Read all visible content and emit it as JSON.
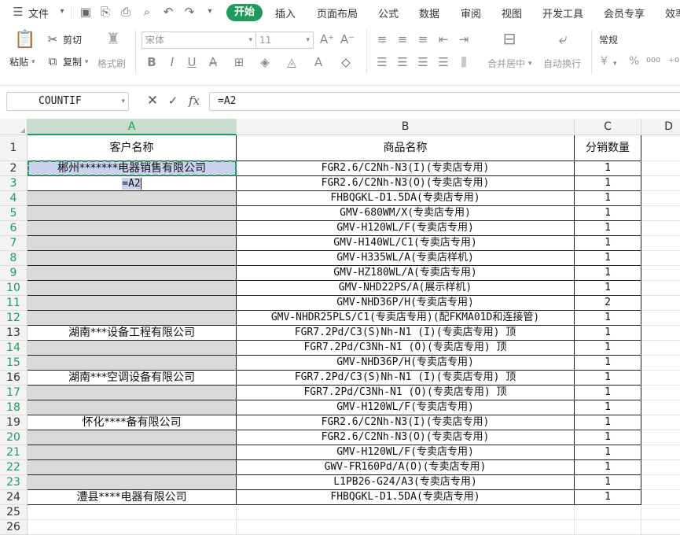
{
  "menu": {
    "file": "文件",
    "tabs": [
      "开始",
      "插入",
      "页面布局",
      "公式",
      "数据",
      "审阅",
      "视图",
      "开发工具",
      "会员专享",
      "效率"
    ]
  },
  "ribbon": {
    "paste": "粘贴",
    "cut": "剪切",
    "copy": "复制",
    "format_painter": "格式刷",
    "font_name": "宋体",
    "font_size": "11",
    "merge_center": "合并居中",
    "wrap_text": "自动换行",
    "number_format": "常规",
    "currency_symbol": "¥",
    "percent_symbol": "%"
  },
  "formula_bar": {
    "name_box": "COUNTIF",
    "fx": "fx",
    "formula": "=A2"
  },
  "columns": [
    "A",
    "B",
    "C",
    "D"
  ],
  "rows": [
    {
      "num": "1",
      "a": "客户名称",
      "b": "商品名称",
      "c": "分销数量"
    },
    {
      "num": "2",
      "a": "郴州*******电器销售有限公司",
      "b": "FGR2.6/C2Nh-N3(I)(专卖店专用)",
      "c": "1"
    },
    {
      "num": "3",
      "a": "=A2",
      "b": "FGR2.6/C2Nh-N3(O)(专卖店专用)",
      "c": "1"
    },
    {
      "num": "4",
      "a": "",
      "b": "FHBQGKL-D1.5DA(专卖店专用)",
      "c": "1"
    },
    {
      "num": "5",
      "a": "",
      "b": "GMV-680WM/X(专卖店专用)",
      "c": "1"
    },
    {
      "num": "6",
      "a": "",
      "b": "GMV-H120WL/F(专卖店专用)",
      "c": "1"
    },
    {
      "num": "7",
      "a": "",
      "b": "GMV-H140WL/C1(专卖店专用)",
      "c": "1"
    },
    {
      "num": "8",
      "a": "",
      "b": "GMV-H335WL/A(专卖店样机)",
      "c": "1"
    },
    {
      "num": "9",
      "a": "",
      "b": "GMV-HZ180WL/A(专卖店专用)",
      "c": "1"
    },
    {
      "num": "10",
      "a": "",
      "b": "GMV-NHD22PS/A(展示样机)",
      "c": "1"
    },
    {
      "num": "11",
      "a": "",
      "b": "GMV-NHD36P/H(专卖店专用)",
      "c": "2"
    },
    {
      "num": "12",
      "a": "",
      "b": "GMV-NHDR25PLS/C1(专卖店专用)(配FKMA01D和连接管)",
      "c": "1"
    },
    {
      "num": "13",
      "a": "湖南***设备工程有限公司",
      "b": "FGR7.2Pd/C3(S)Nh-N1 (I)(专卖店专用) 顶",
      "c": "1"
    },
    {
      "num": "14",
      "a": "",
      "b": "FGR7.2Pd/C3Nh-N1 (O)(专卖店专用) 顶",
      "c": "1"
    },
    {
      "num": "15",
      "a": "",
      "b": "GMV-NHD36P/H(专卖店专用)",
      "c": "1"
    },
    {
      "num": "16",
      "a": "湖南***空调设备有限公司",
      "b": "FGR7.2Pd/C3(S)Nh-N1 (I)(专卖店专用) 顶",
      "c": "1"
    },
    {
      "num": "17",
      "a": "",
      "b": "FGR7.2Pd/C3Nh-N1 (O)(专卖店专用) 顶",
      "c": "1"
    },
    {
      "num": "18",
      "a": "",
      "b": "GMV-H120WL/F(专卖店专用)",
      "c": "1"
    },
    {
      "num": "19",
      "a": "怀化****备有限公司",
      "b": "FGR2.6/C2Nh-N3(I)(专卖店专用)",
      "c": "1"
    },
    {
      "num": "20",
      "a": "",
      "b": "FGR2.6/C2Nh-N3(O)(专卖店专用)",
      "c": "1"
    },
    {
      "num": "21",
      "a": "",
      "b": "GMV-H120WL/F(专卖店专用)",
      "c": "1"
    },
    {
      "num": "22",
      "a": "",
      "b": "GWV-FR160Pd/A(O)(专卖店专用)",
      "c": "1"
    },
    {
      "num": "23",
      "a": "",
      "b": "L1PB26-G24/A3(专卖店专用)",
      "c": "1"
    },
    {
      "num": "24",
      "a": "澧县****电器有限公司",
      "b": "FHBQGKL-D1.5DA(专卖店专用)",
      "c": "1"
    },
    {
      "num": "25",
      "a": "",
      "b": "",
      "c": ""
    },
    {
      "num": "26",
      "a": "",
      "b": "",
      "c": ""
    }
  ],
  "highlight_color": "#1e9b5a",
  "gray_fill": "#d9d9d9"
}
